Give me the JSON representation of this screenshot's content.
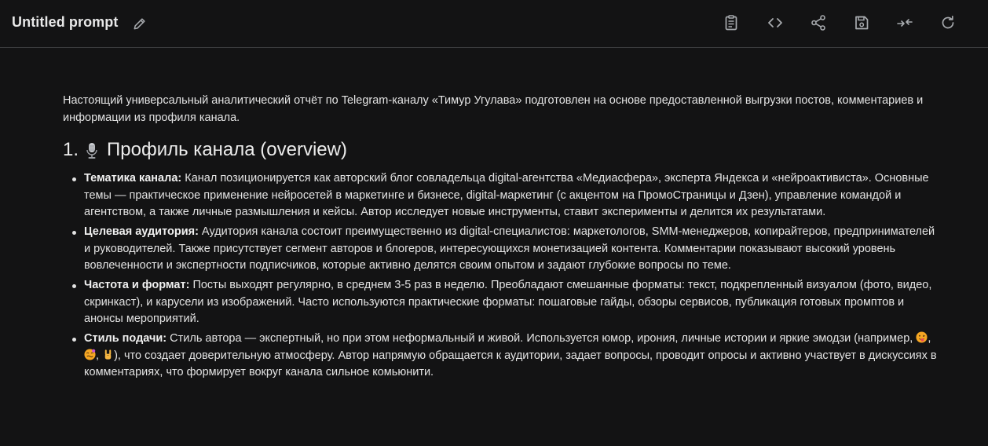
{
  "header": {
    "title": "Untitled prompt"
  },
  "document": {
    "intro": "Настоящий универсальный аналитический отчёт по Telegram-каналу «Тимур Угулава» подготовлен на основе предоставленной выгрузки постов, комментариев и информации из профиля канала.",
    "section_number": "1.",
    "section_title": "Профиль канала (overview)",
    "bullets": [
      {
        "term": "Тематика канала:",
        "text": " Канал позиционируется как авторский блог совладельца digital-агентства «Медиасфера», эксперта Яндекса и «нейроактивиста». Основные темы — практическое применение нейросетей в маркетинге и бизнесе, digital-маркетинг (с акцентом на ПромоСтраницы и Дзен), управление командой и агентством, а также личные размышления и кейсы. Автор исследует новые инструменты, ставит эксперименты и делится их результатами."
      },
      {
        "term": "Целевая аудитория:",
        "text": " Аудитория канала состоит преимущественно из digital-специалистов: маркетологов, SMM-менеджеров, копирайтеров, предпринимателей и руководителей. Также присутствует сегмент авторов и блогеров, интересующихся монетизацией контента. Комментарии показывают высокий уровень вовлеченности и экспертности подписчиков, которые активно делятся своим опытом и задают глубокие вопросы по теме."
      },
      {
        "term": "Частота и формат:",
        "text": " Посты выходят регулярно, в среднем 3-5 раз в неделю. Преобладают смешанные форматы: текст, подкрепленный визуалом (фото, видео, скринкаст), и карусели из изображений. Часто используются практические форматы: пошаговые гайды, обзоры сервисов, публикация готовых промптов и анонсы мероприятий."
      },
      {
        "term": "Стиль подачи:",
        "text_before": " Стиль автора — экспертный, но при этом неформальный и живой. Используется юмор, ирония, личные истории и яркие эмодзи (например, ",
        "sep1": ", ",
        "sep2": ", ",
        "text_after": "), что создает доверительную атмосферу. Автор напрямую обращается к аудитории, задает вопросы, проводит опросы и активно участвует в дискуссиях в комментариях, что формирует вокруг канала сильное комьюнити."
      }
    ]
  },
  "icons": {
    "edit": "pencil-icon",
    "toolbar": [
      "clipboard-icon",
      "code-icon",
      "share-icon",
      "save-icon",
      "compare-icon",
      "refresh-icon"
    ],
    "heading": "microphone-icon",
    "emojis": [
      "tongue-face-emoji",
      "dizzy-face-emoji",
      "rock-hand-emoji"
    ]
  },
  "colors": {
    "background": "#131314",
    "text": "#e3e3e3",
    "icon": "#a8abaf",
    "divider": "#3a3b3d"
  }
}
